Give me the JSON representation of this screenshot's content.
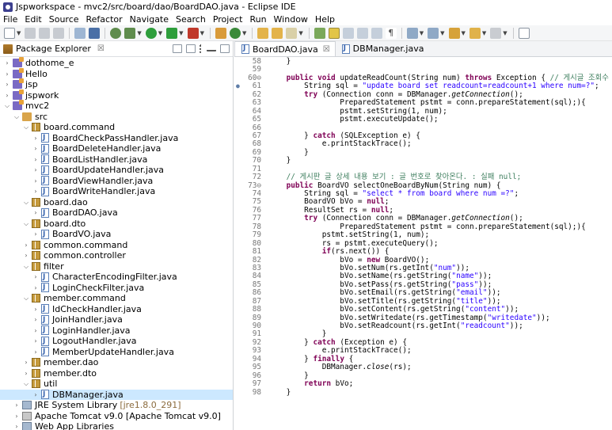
{
  "window": {
    "title": "Jspworkspace - mvc2/src/board/dao/BoardDAO.java - Eclipse IDE"
  },
  "menu": [
    "File",
    "Edit",
    "Source",
    "Refactor",
    "Navigate",
    "Search",
    "Project",
    "Run",
    "Window",
    "Help"
  ],
  "package_explorer": {
    "title": "Package Explorer",
    "close": "☒",
    "tree": [
      {
        "indent": 0,
        "twisty": ">",
        "icon": "project",
        "label": "dothome_e"
      },
      {
        "indent": 0,
        "twisty": ">",
        "icon": "project",
        "label": "Hello"
      },
      {
        "indent": 0,
        "twisty": ">",
        "icon": "project",
        "label": "jsp"
      },
      {
        "indent": 0,
        "twisty": ">",
        "icon": "project",
        "label": "jspwork"
      },
      {
        "indent": 0,
        "twisty": "v",
        "icon": "project",
        "label": "mvc2"
      },
      {
        "indent": 1,
        "twisty": "v",
        "icon": "src",
        "label": "src"
      },
      {
        "indent": 2,
        "twisty": "v",
        "icon": "pkg",
        "label": "board.command"
      },
      {
        "indent": 3,
        "twisty": ">",
        "icon": "java",
        "label": "BoardCheckPassHandler.java"
      },
      {
        "indent": 3,
        "twisty": ">",
        "icon": "java",
        "label": "BoardDeleteHandler.java"
      },
      {
        "indent": 3,
        "twisty": ">",
        "icon": "java",
        "label": "BoardListHandler.java"
      },
      {
        "indent": 3,
        "twisty": ">",
        "icon": "java",
        "label": "BoardUpdateHandler.java"
      },
      {
        "indent": 3,
        "twisty": ">",
        "icon": "java",
        "label": "BoardViewHandler.java"
      },
      {
        "indent": 3,
        "twisty": ">",
        "icon": "java",
        "label": "BoardWriteHandler.java"
      },
      {
        "indent": 2,
        "twisty": "v",
        "icon": "pkg",
        "label": "board.dao"
      },
      {
        "indent": 3,
        "twisty": ">",
        "icon": "java",
        "label": "BoardDAO.java"
      },
      {
        "indent": 2,
        "twisty": "v",
        "icon": "pkg",
        "label": "board.dto"
      },
      {
        "indent": 3,
        "twisty": ">",
        "icon": "java",
        "label": "BoardVO.java"
      },
      {
        "indent": 2,
        "twisty": ">",
        "icon": "pkg",
        "label": "common.command"
      },
      {
        "indent": 2,
        "twisty": ">",
        "icon": "pkg",
        "label": "common.controller"
      },
      {
        "indent": 2,
        "twisty": "v",
        "icon": "pkg",
        "label": "filter"
      },
      {
        "indent": 3,
        "twisty": ">",
        "icon": "java",
        "label": "CharacterEncodingFilter.java"
      },
      {
        "indent": 3,
        "twisty": ">",
        "icon": "java",
        "label": "LoginCheckFilter.java"
      },
      {
        "indent": 2,
        "twisty": "v",
        "icon": "pkg",
        "label": "member.command"
      },
      {
        "indent": 3,
        "twisty": ">",
        "icon": "java",
        "label": "IdCheckHandler.java"
      },
      {
        "indent": 3,
        "twisty": ">",
        "icon": "java",
        "label": "JoinHandler.java"
      },
      {
        "indent": 3,
        "twisty": ">",
        "icon": "java",
        "label": "LoginHandler.java"
      },
      {
        "indent": 3,
        "twisty": ">",
        "icon": "java",
        "label": "LogoutHandler.java"
      },
      {
        "indent": 3,
        "twisty": ">",
        "icon": "java",
        "label": "MemberUpdateHandler.java"
      },
      {
        "indent": 2,
        "twisty": ">",
        "icon": "pkg",
        "label": "member.dao"
      },
      {
        "indent": 2,
        "twisty": ">",
        "icon": "pkg",
        "label": "member.dto"
      },
      {
        "indent": 2,
        "twisty": "v",
        "icon": "pkg",
        "label": "util"
      },
      {
        "indent": 3,
        "twisty": ">",
        "icon": "java",
        "label": "DBManager.java",
        "selected": true
      },
      {
        "indent": 1,
        "twisty": ">",
        "icon": "lib",
        "label": "JRE System Library",
        "tag": "[jre1.8.0_291]"
      },
      {
        "indent": 1,
        "twisty": ">",
        "icon": "server",
        "label": "Apache Tomcat v9.0 [Apache Tomcat v9.0]"
      },
      {
        "indent": 1,
        "twisty": ">",
        "icon": "lib",
        "label": "Web App Libraries"
      }
    ]
  },
  "editor": {
    "tabs": [
      {
        "label": "BoardDAO.java",
        "active": true,
        "close": "☒"
      },
      {
        "label": "DBManager.java",
        "active": false
      }
    ],
    "lines": [
      {
        "n": "58",
        "segs": [
          [
            "",
            "    }"
          ]
        ]
      },
      {
        "n": "59",
        "segs": [
          [
            "",
            ""
          ]
        ]
      },
      {
        "n": "60⊖",
        "segs": [
          [
            "kw",
            "    public void "
          ],
          [
            "",
            "updateReadCount(String num) "
          ],
          [
            "kw",
            "throws "
          ],
          [
            "",
            "Exception { "
          ],
          [
            "cm",
            "// 게시글 조회수 갱신"
          ]
        ]
      },
      {
        "n": "61",
        "mark": "●",
        "segs": [
          [
            "",
            "        String sql = "
          ],
          [
            "str",
            "\"update board set readcount=readcount+1 where num=?\""
          ],
          [
            "",
            ";"
          ]
        ]
      },
      {
        "n": "62",
        "segs": [
          [
            "kw",
            "        try "
          ],
          [
            "",
            "(Connection conn = DBManager."
          ],
          [
            "it",
            "getConnection"
          ],
          [
            "",
            "();"
          ]
        ]
      },
      {
        "n": "63",
        "segs": [
          [
            "",
            "                PreparedStatement pstmt = conn.prepareStatement(sql);){"
          ]
        ]
      },
      {
        "n": "64",
        "segs": [
          [
            "",
            "                pstmt.setString(1, num);"
          ]
        ]
      },
      {
        "n": "65",
        "segs": [
          [
            "",
            "                pstmt.executeUpdate();"
          ]
        ]
      },
      {
        "n": "66",
        "segs": [
          [
            "",
            ""
          ]
        ]
      },
      {
        "n": "67",
        "segs": [
          [
            "",
            "        } "
          ],
          [
            "kw",
            "catch "
          ],
          [
            "",
            "(SQLException e) {"
          ]
        ]
      },
      {
        "n": "68",
        "segs": [
          [
            "",
            "            e.printStackTrace();"
          ]
        ]
      },
      {
        "n": "69",
        "segs": [
          [
            "",
            "        }"
          ]
        ]
      },
      {
        "n": "70",
        "segs": [
          [
            "",
            "    }"
          ]
        ]
      },
      {
        "n": "71",
        "segs": [
          [
            "",
            ""
          ]
        ]
      },
      {
        "n": "72",
        "segs": [
          [
            "cm",
            "    // 게시판 글 상세 내용 보기 : 글 번호로 찾아온다. : 실패 null;"
          ]
        ]
      },
      {
        "n": "73⊖",
        "segs": [
          [
            "kw",
            "    public "
          ],
          [
            "",
            "BoardVO selectOneBoardByNum(String num) {"
          ]
        ]
      },
      {
        "n": "74",
        "segs": [
          [
            "",
            "        String sql = "
          ],
          [
            "str",
            "\"select * from board where num =?\""
          ],
          [
            "",
            ";"
          ]
        ]
      },
      {
        "n": "75",
        "segs": [
          [
            "",
            "        BoardVO bVo = "
          ],
          [
            "kw",
            "null"
          ],
          [
            "",
            ";"
          ]
        ]
      },
      {
        "n": "76",
        "segs": [
          [
            "",
            "        ResultSet rs = "
          ],
          [
            "kw",
            "null"
          ],
          [
            "",
            ";"
          ]
        ]
      },
      {
        "n": "77",
        "segs": [
          [
            "kw",
            "        try "
          ],
          [
            "",
            "(Connection conn = DBManager."
          ],
          [
            "it",
            "getConnection"
          ],
          [
            "",
            "();"
          ]
        ]
      },
      {
        "n": "78",
        "segs": [
          [
            "",
            "                PreparedStatement pstmt = conn.prepareStatement(sql);){"
          ]
        ]
      },
      {
        "n": "79",
        "segs": [
          [
            "",
            "            pstmt.setString(1, num);"
          ]
        ]
      },
      {
        "n": "80",
        "segs": [
          [
            "",
            "            rs = pstmt.executeQuery();"
          ]
        ]
      },
      {
        "n": "81",
        "segs": [
          [
            "kw",
            "            if"
          ],
          [
            "",
            "(rs.next()) {"
          ]
        ]
      },
      {
        "n": "82",
        "segs": [
          [
            "",
            "                bVo = "
          ],
          [
            "kw",
            "new "
          ],
          [
            "",
            "BoardVO();"
          ]
        ]
      },
      {
        "n": "83",
        "segs": [
          [
            "",
            "                bVo.setNum(rs.getInt("
          ],
          [
            "str",
            "\"num\""
          ],
          [
            "",
            "));"
          ]
        ]
      },
      {
        "n": "84",
        "segs": [
          [
            "",
            "                bVo.setName(rs.getString("
          ],
          [
            "str",
            "\"name\""
          ],
          [
            "",
            "));"
          ]
        ]
      },
      {
        "n": "85",
        "segs": [
          [
            "",
            "                bVo.setPass(rs.getString("
          ],
          [
            "str",
            "\"pass\""
          ],
          [
            "",
            "));"
          ]
        ]
      },
      {
        "n": "86",
        "segs": [
          [
            "",
            "                bVo.setEmail(rs.getString("
          ],
          [
            "str",
            "\"email\""
          ],
          [
            "",
            "));"
          ]
        ]
      },
      {
        "n": "87",
        "segs": [
          [
            "",
            "                bVo.setTitle(rs.getString("
          ],
          [
            "str",
            "\"title\""
          ],
          [
            "",
            "));"
          ]
        ]
      },
      {
        "n": "88",
        "segs": [
          [
            "",
            "                bVo.setContent(rs.getString("
          ],
          [
            "str",
            "\"content\""
          ],
          [
            "",
            "));"
          ]
        ]
      },
      {
        "n": "89",
        "segs": [
          [
            "",
            "                bVo.setWritedate(rs.getTimestamp("
          ],
          [
            "str",
            "\"writedate\""
          ],
          [
            "",
            "));"
          ]
        ]
      },
      {
        "n": "90",
        "segs": [
          [
            "",
            "                bVo.setReadcount(rs.getInt("
          ],
          [
            "str",
            "\"readcount\""
          ],
          [
            "",
            "));"
          ]
        ]
      },
      {
        "n": "91",
        "segs": [
          [
            "",
            "            }"
          ]
        ]
      },
      {
        "n": "92",
        "segs": [
          [
            "",
            "        } "
          ],
          [
            "kw",
            "catch "
          ],
          [
            "",
            "(Exception e) {"
          ]
        ]
      },
      {
        "n": "93",
        "segs": [
          [
            "",
            "            e.printStackTrace();"
          ]
        ]
      },
      {
        "n": "94",
        "segs": [
          [
            "",
            "        } "
          ],
          [
            "kw",
            "finally "
          ],
          [
            "",
            "{"
          ]
        ]
      },
      {
        "n": "95",
        "segs": [
          [
            "",
            "            DBManager."
          ],
          [
            "it",
            "close"
          ],
          [
            "",
            "(rs);"
          ]
        ]
      },
      {
        "n": "96",
        "segs": [
          [
            "",
            "        }"
          ]
        ]
      },
      {
        "n": "97",
        "segs": [
          [
            "kw",
            "        return "
          ],
          [
            "",
            "bVo;"
          ]
        ]
      },
      {
        "n": "98",
        "segs": [
          [
            "",
            "    }"
          ]
        ]
      }
    ]
  }
}
